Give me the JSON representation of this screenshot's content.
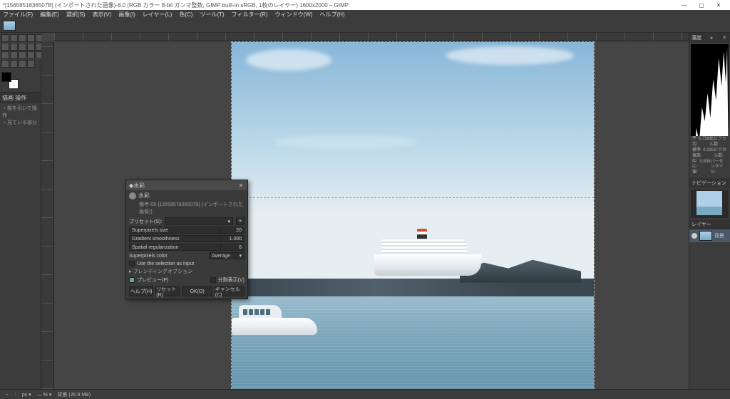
{
  "title": "*[1565851836507B] (インポートされた画像)-8.0 (RGB カラー 8-bit ガンマ整数, GIMP built-in sRGB, 1枚のレイヤー) 1600x2000 – GIMP",
  "menu": [
    "ファイル(F)",
    "編集(E)",
    "選択(S)",
    "表示(V)",
    "画像(I)",
    "レイヤー(L)",
    "色(C)",
    "ツール(T)",
    "フィルター(R)",
    "ウィンドウ(W)",
    "ヘルプ(H)"
  ],
  "tool_options_title": "描画 操作",
  "tool_options_sub1": "・部を引いて操作",
  "tool_options_sub2": "・見ている部分",
  "dialog": {
    "title": "水彩",
    "heading": "水彩",
    "meta": "備考-05-[1565957836507B] (インポートされた画像))",
    "preset_label": "プリセット(S):",
    "preset_add": "+",
    "params": [
      {
        "label": "Superpixels size",
        "value": "20"
      },
      {
        "label": "Gradient smoothness",
        "value": "1.300"
      },
      {
        "label": "Spatial regularization",
        "value": "6"
      }
    ],
    "color_label": "Superpixels color",
    "color_value": "Average",
    "use_sel": "Use the selection as input",
    "blend": "ブレンディングオプション",
    "preview": "プレビュー(P)",
    "split": "分割表示(V)",
    "btns": [
      "ヘルプ(H)",
      "リセット(R)",
      "OK(O)",
      "キャンセル(C)"
    ]
  },
  "right": {
    "tab_histo": "濃度",
    "stats": {
      "avg_l": "平均:",
      "avg_v": "0.758",
      "total_l": "総ピクセル数:",
      "std_l": "標準偏差:",
      "std_v": "0.235",
      "count_l": "ピクセル数:",
      "med_l": "中心値:",
      "med_v": "0.838",
      "pct_l": "パーセンタイル:"
    },
    "nav_tab": "ナビゲーション",
    "layers_tab": "レイヤー",
    "layer_name": "背景"
  },
  "status": {
    "coords": "→ ",
    "unit": "px",
    "zoom_dd": "▾",
    "info": "背景 (26.9 MB)"
  }
}
